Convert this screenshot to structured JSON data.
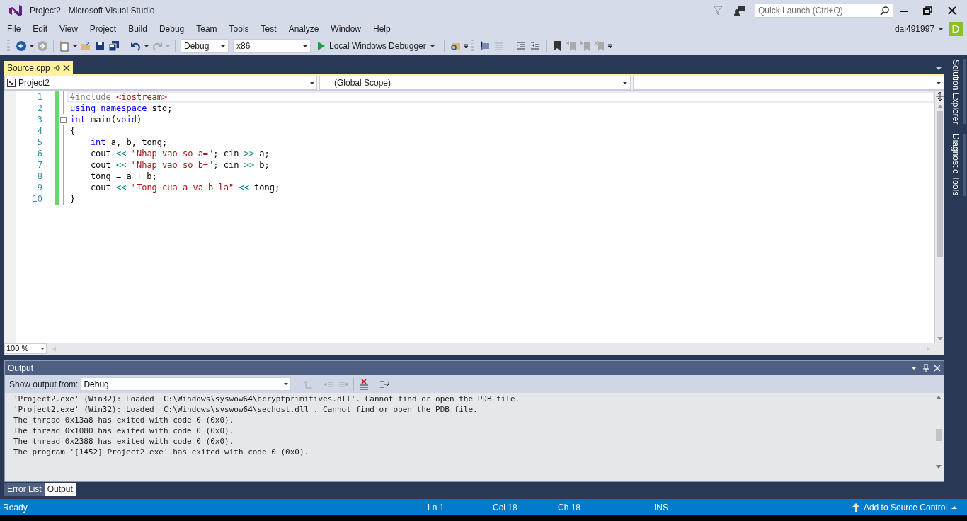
{
  "window": {
    "title": "Project2 - Microsoft Visual Studio"
  },
  "quick_launch": {
    "placeholder": "Quick Launch (Ctrl+Q)"
  },
  "account": {
    "user": "dai491997",
    "avatar_letter": "D"
  },
  "menu": [
    "File",
    "Edit",
    "View",
    "Project",
    "Build",
    "Debug",
    "Team",
    "Tools",
    "Test",
    "Analyze",
    "Window",
    "Help"
  ],
  "toolbar": {
    "configuration": "Debug",
    "platform": "x86",
    "start": "Local Windows Debugger"
  },
  "document_tabs": [
    {
      "label": "Source.cpp",
      "selected": true
    }
  ],
  "navigation": {
    "project": "Project2",
    "scope": "(Global Scope)"
  },
  "code": [
    {
      "number": "1",
      "fold": false,
      "current": true,
      "tokens": [
        {
          "kind": "pp",
          "text": "#include "
        },
        {
          "kind": "inc",
          "text": "<iostream>"
        }
      ]
    },
    {
      "number": "2",
      "fold": false,
      "current": false,
      "tokens": [
        {
          "kind": "kw",
          "text": "using namespace"
        },
        {
          "kind": "plain",
          "text": " std;"
        }
      ]
    },
    {
      "number": "3",
      "fold": true,
      "current": false,
      "tokens": [
        {
          "kind": "kw",
          "text": "int"
        },
        {
          "kind": "plain",
          "text": " main("
        },
        {
          "kind": "kw",
          "text": "void"
        },
        {
          "kind": "plain",
          "text": ")"
        }
      ]
    },
    {
      "number": "4",
      "fold": false,
      "current": false,
      "tokens": [
        {
          "kind": "plain",
          "text": "{"
        }
      ]
    },
    {
      "number": "5",
      "fold": false,
      "current": false,
      "tokens": [
        {
          "kind": "kw",
          "text": "    int"
        },
        {
          "kind": "plain",
          "text": " a, b, tong;"
        }
      ]
    },
    {
      "number": "6",
      "fold": false,
      "current": false,
      "tokens": [
        {
          "kind": "plain",
          "text": "    cout "
        },
        {
          "kind": "op",
          "text": "<<"
        },
        {
          "kind": "str",
          "text": " \"Nhap vao so a=\""
        },
        {
          "kind": "plain",
          "text": "; cin "
        },
        {
          "kind": "op",
          "text": ">>"
        },
        {
          "kind": "plain",
          "text": " a;"
        }
      ]
    },
    {
      "number": "7",
      "fold": false,
      "current": false,
      "tokens": [
        {
          "kind": "plain",
          "text": "    cout "
        },
        {
          "kind": "op",
          "text": "<<"
        },
        {
          "kind": "str",
          "text": " \"Nhap vao so b=\""
        },
        {
          "kind": "plain",
          "text": "; cin "
        },
        {
          "kind": "op",
          "text": ">>"
        },
        {
          "kind": "plain",
          "text": " b;"
        }
      ]
    },
    {
      "number": "8",
      "fold": false,
      "current": false,
      "tokens": [
        {
          "kind": "plain",
          "text": "    tong = a + b;"
        }
      ]
    },
    {
      "number": "9",
      "fold": false,
      "current": false,
      "tokens": [
        {
          "kind": "plain",
          "text": "    cout "
        },
        {
          "kind": "op",
          "text": "<<"
        },
        {
          "kind": "str",
          "text": " \"Tong cua a va b la\" "
        },
        {
          "kind": "op",
          "text": "<<"
        },
        {
          "kind": "plain",
          "text": " tong;"
        }
      ]
    },
    {
      "number": "10",
      "fold": false,
      "current": false,
      "tokens": [
        {
          "kind": "plain",
          "text": "}"
        }
      ]
    }
  ],
  "zoom": "100 %",
  "output": {
    "title": "Output",
    "show_from_label": "Show output from:",
    "source": "Debug",
    "lines": [
      "'Project2.exe' (Win32): Loaded 'C:\\Windows\\syswow64\\bcryptprimitives.dll'. Cannot find or open the PDB file.",
      "'Project2.exe' (Win32): Loaded 'C:\\Windows\\syswow64\\sechost.dll'. Cannot find or open the PDB file.",
      "The thread 0x13a8 has exited with code 0 (0x0).",
      "The thread 0x1080 has exited with code 0 (0x0).",
      "The thread 0x2388 has exited with code 0 (0x0).",
      "The program '[1452] Project2.exe' has exited with code 0 (0x0)."
    ]
  },
  "bottom_tabs": [
    {
      "label": "Error List",
      "selected": false
    },
    {
      "label": "Output",
      "selected": true
    }
  ],
  "side_tabs": [
    "Solution Explorer",
    "Diagnostic Tools"
  ],
  "status_bar": {
    "state": "Ready",
    "line": "Ln 1",
    "column": "Col 18",
    "char": "Ch 18",
    "mode": "INS",
    "source_control": "Add to Source Control"
  }
}
